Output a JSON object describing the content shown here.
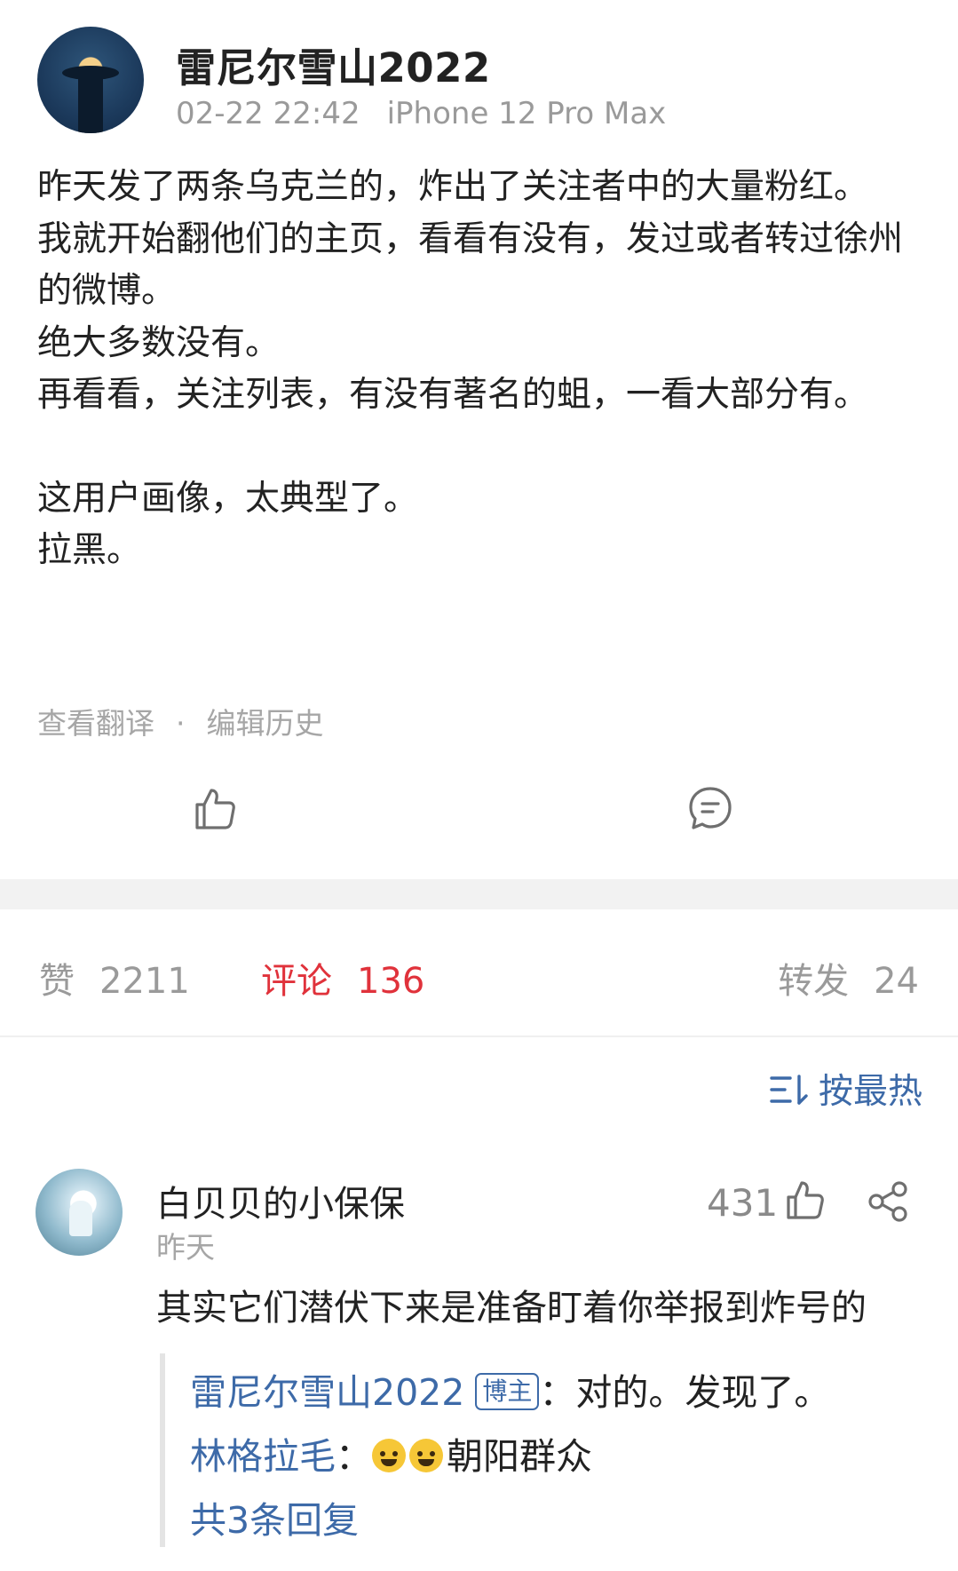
{
  "post": {
    "author": "雷尼尔雪山2022",
    "timestamp": "02-22 22:42",
    "device": "iPhone 12 Pro Max",
    "paragraphs": [
      "昨天发了两条乌克兰的，炸出了关注者中的大量粉红。",
      "我就开始翻他们的主页，看看有没有，发过或者转过徐州的微博。",
      "绝大多数没有。",
      "再看看，关注列表，有没有著名的蛆，一看大部分有。",
      "",
      "这用户画像，太典型了。",
      "拉黑。"
    ],
    "translate_link": "查看翻译",
    "separator": "·",
    "edit_history_link": "编辑历史"
  },
  "stats": {
    "likes_label": "赞",
    "likes_value": "2211",
    "comments_label": "评论",
    "comments_value": "136",
    "reposts_label": "转发",
    "reposts_value": "24"
  },
  "sort": {
    "label": "按最热"
  },
  "comment": {
    "author": "白贝贝的小保保",
    "time": "昨天",
    "likes": "431",
    "text": "其实它们潜伏下来是准备盯着你举报到炸号的",
    "replies": [
      {
        "name": "雷尼尔雪山2022",
        "tag": "博主",
        "text": "：对的。发现了。"
      },
      {
        "name": "林格拉毛",
        "text": "：",
        "emoji": [
          "laugh-cry-emoji",
          "laugh-cry-emoji"
        ],
        "after": "朝阳群众"
      }
    ],
    "more_replies": "共3条回复"
  },
  "colors": {
    "link_blue": "#3d6aa8",
    "active_red": "#e0323b",
    "muted_gray": "#9a9a9a"
  }
}
